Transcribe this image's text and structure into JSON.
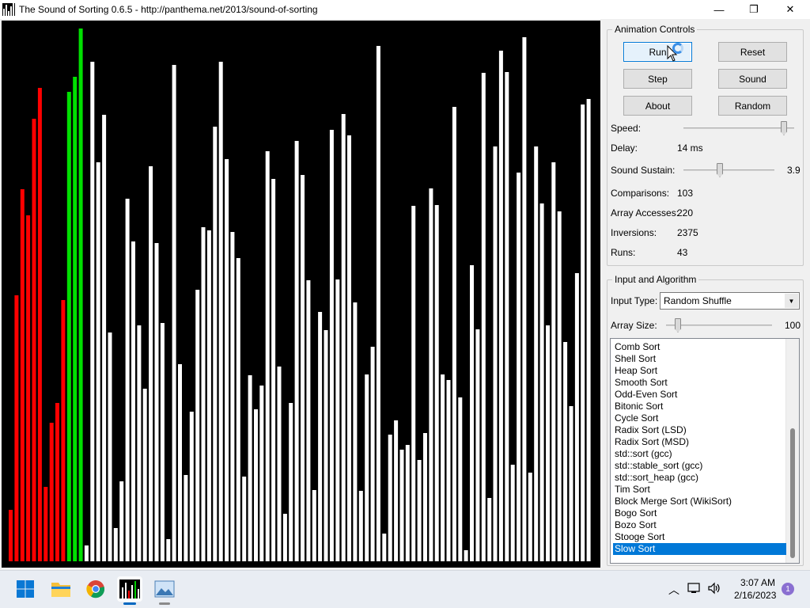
{
  "window": {
    "title": "The Sound of Sorting 0.6.5 - http://panthema.net/2013/sound-of-sorting",
    "minimize_glyph": "—",
    "maximize_glyph": "❐",
    "close_glyph": "✕"
  },
  "visualization": {
    "values": [
      65,
      336,
      470,
      437,
      559,
      598,
      94,
      175,
      200,
      330,
      593,
      612,
      673,
      20,
      631,
      504,
      564,
      289,
      42,
      101,
      458,
      404,
      298,
      218,
      499,
      402,
      301,
      28,
      627,
      249,
      109,
      189,
      343,
      422,
      418,
      549,
      631,
      508,
      416,
      383,
      107,
      235,
      192,
      222,
      518,
      483,
      246,
      60,
      200,
      531,
      488,
      355,
      90,
      315,
      292,
      545,
      356,
      565,
      538,
      327,
      89,
      236,
      271,
      651,
      35,
      160,
      178,
      141,
      147,
      449,
      128,
      162,
      471,
      450,
      236,
      229,
      574,
      207,
      14,
      374,
      293,
      617,
      80,
      524,
      645,
      618,
      122,
      491,
      662,
      112,
      524,
      452,
      298,
      504,
      442,
      277,
      196,
      364,
      577,
      584
    ],
    "colors": {
      "default": "#ffffff",
      "compare": "#ff0000",
      "active": "#00e000",
      "background": "#000000"
    },
    "highlights": {
      "0": "compare",
      "1": "compare",
      "2": "compare",
      "3": "compare",
      "4": "compare",
      "5": "compare",
      "6": "compare",
      "7": "compare",
      "8": "compare",
      "9": "compare",
      "10": "active",
      "11": "active",
      "12": "active"
    }
  },
  "animation_controls": {
    "title": "Animation Controls",
    "buttons": {
      "run": "Run",
      "reset": "Reset",
      "step": "Step",
      "sound": "Sound",
      "about": "About",
      "random": "Random"
    },
    "speed_label": "Speed:",
    "speed_level": 0.93,
    "delay_label": "Delay:",
    "delay_value": "14 ms",
    "sustain_label": "Sound Sustain:",
    "sustain_value": "3.9",
    "sustain_level": 0.39,
    "stats": [
      {
        "label": "Comparisons:",
        "value": "103"
      },
      {
        "label": "Array Accesses:",
        "value": "220"
      },
      {
        "label": "Inversions:",
        "value": "2375"
      },
      {
        "label": "Runs:",
        "value": "43"
      }
    ]
  },
  "input_algorithm": {
    "title": "Input and Algorithm",
    "input_type_label": "Input Type:",
    "input_type_value": "Random Shuffle",
    "array_size_label": "Array Size:",
    "array_size_value": "100",
    "array_size_level": 0.09,
    "algorithms": [
      "Comb Sort",
      "Shell Sort",
      "Heap Sort",
      "Smooth Sort",
      "Odd-Even Sort",
      "Bitonic Sort",
      "Cycle Sort",
      "Radix Sort (LSD)",
      "Radix Sort (MSD)",
      "std::sort (gcc)",
      "std::stable_sort (gcc)",
      "std::sort_heap (gcc)",
      "Tim Sort",
      "Block Merge Sort (WikiSort)",
      "Bogo Sort",
      "Bozo Sort",
      "Stooge Sort",
      "Slow Sort"
    ],
    "selected_algorithm": "Slow Sort"
  },
  "taskbar": {
    "icons": [
      "windows-start-icon",
      "file-explorer-icon",
      "chrome-icon",
      "sound-of-sorting-icon",
      "image-viewer-icon"
    ],
    "chevron_glyph": "︿",
    "time": "3:07 AM",
    "date": "2/16/2023",
    "notification_count": "1"
  }
}
